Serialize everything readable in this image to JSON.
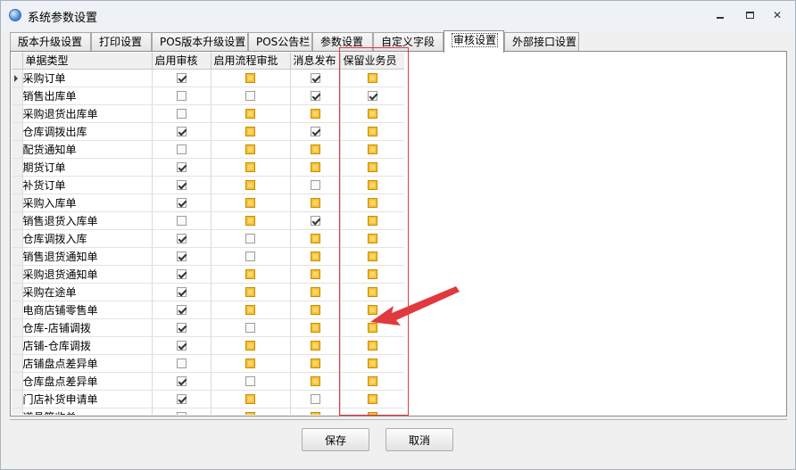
{
  "window": {
    "title": "系统参数设置"
  },
  "tabs": [
    {
      "label": "版本升级设置"
    },
    {
      "label": "打印设置"
    },
    {
      "label": "POS版本升级设置"
    },
    {
      "label": "POS公告栏"
    },
    {
      "label": "参数设置"
    },
    {
      "label": "自定义字段"
    },
    {
      "label": "审核设置"
    },
    {
      "label": "外部接口设置"
    }
  ],
  "grid": {
    "columns": [
      "单据类型",
      "启用审核",
      "启用流程审批",
      "消息发布",
      "保留业务员"
    ],
    "rows": [
      {
        "name": "采购订单",
        "audit": "check-on",
        "flow": "orange",
        "msg": "check-on",
        "keep": "orange",
        "current": true
      },
      {
        "name": "销售出库单",
        "audit": "check-off",
        "flow": "check-off",
        "msg": "check-on",
        "keep": "check-on"
      },
      {
        "name": "采购退货出库单",
        "audit": "check-off",
        "flow": "orange",
        "msg": "orange",
        "keep": "orange"
      },
      {
        "name": "仓库调拨出库",
        "audit": "check-on",
        "flow": "orange",
        "msg": "check-on",
        "keep": "orange"
      },
      {
        "name": "配货通知单",
        "audit": "check-off",
        "flow": "orange",
        "msg": "orange",
        "keep": "orange"
      },
      {
        "name": "期货订单",
        "audit": "check-on",
        "flow": "orange",
        "msg": "orange",
        "keep": "orange"
      },
      {
        "name": "补货订单",
        "audit": "check-on",
        "flow": "orange",
        "msg": "check-off",
        "keep": "orange"
      },
      {
        "name": "采购入库单",
        "audit": "check-on",
        "flow": "orange",
        "msg": "orange",
        "keep": "orange"
      },
      {
        "name": "销售退货入库单",
        "audit": "check-off",
        "flow": "orange",
        "msg": "check-on",
        "keep": "orange"
      },
      {
        "name": "仓库调拨入库",
        "audit": "check-on",
        "flow": "check-off",
        "msg": "orange",
        "keep": "orange"
      },
      {
        "name": "销售退货通知单",
        "audit": "check-on",
        "flow": "check-off",
        "msg": "orange",
        "keep": "orange"
      },
      {
        "name": "采购退货通知单",
        "audit": "check-on",
        "flow": "orange",
        "msg": "orange",
        "keep": "orange"
      },
      {
        "name": "采购在途单",
        "audit": "check-on",
        "flow": "orange",
        "msg": "orange",
        "keep": "orange"
      },
      {
        "name": "电商店铺零售单",
        "audit": "check-on",
        "flow": "orange",
        "msg": "orange",
        "keep": "orange"
      },
      {
        "name": "仓库-店铺调拨",
        "audit": "check-on",
        "flow": "check-off",
        "msg": "orange",
        "keep": "orange"
      },
      {
        "name": "店铺-仓库调拨",
        "audit": "check-on",
        "flow": "orange",
        "msg": "orange",
        "keep": "orange"
      },
      {
        "name": "店铺盘点差异单",
        "audit": "check-off",
        "flow": "orange",
        "msg": "orange",
        "keep": "orange"
      },
      {
        "name": "仓库盘点差异单",
        "audit": "check-on",
        "flow": "check-off",
        "msg": "orange",
        "keep": "orange"
      },
      {
        "name": "门店补货申请单",
        "audit": "check-on",
        "flow": "orange",
        "msg": "check-off",
        "keep": "orange"
      },
      {
        "name": "道具签收单",
        "audit": "check-on",
        "flow": "orange",
        "msg": "orange",
        "keep": "orange"
      }
    ]
  },
  "buttons": {
    "save": "保存",
    "cancel": "取消"
  },
  "colors": {
    "highlight": "#e0393e",
    "toggle": "#f7c23a"
  }
}
